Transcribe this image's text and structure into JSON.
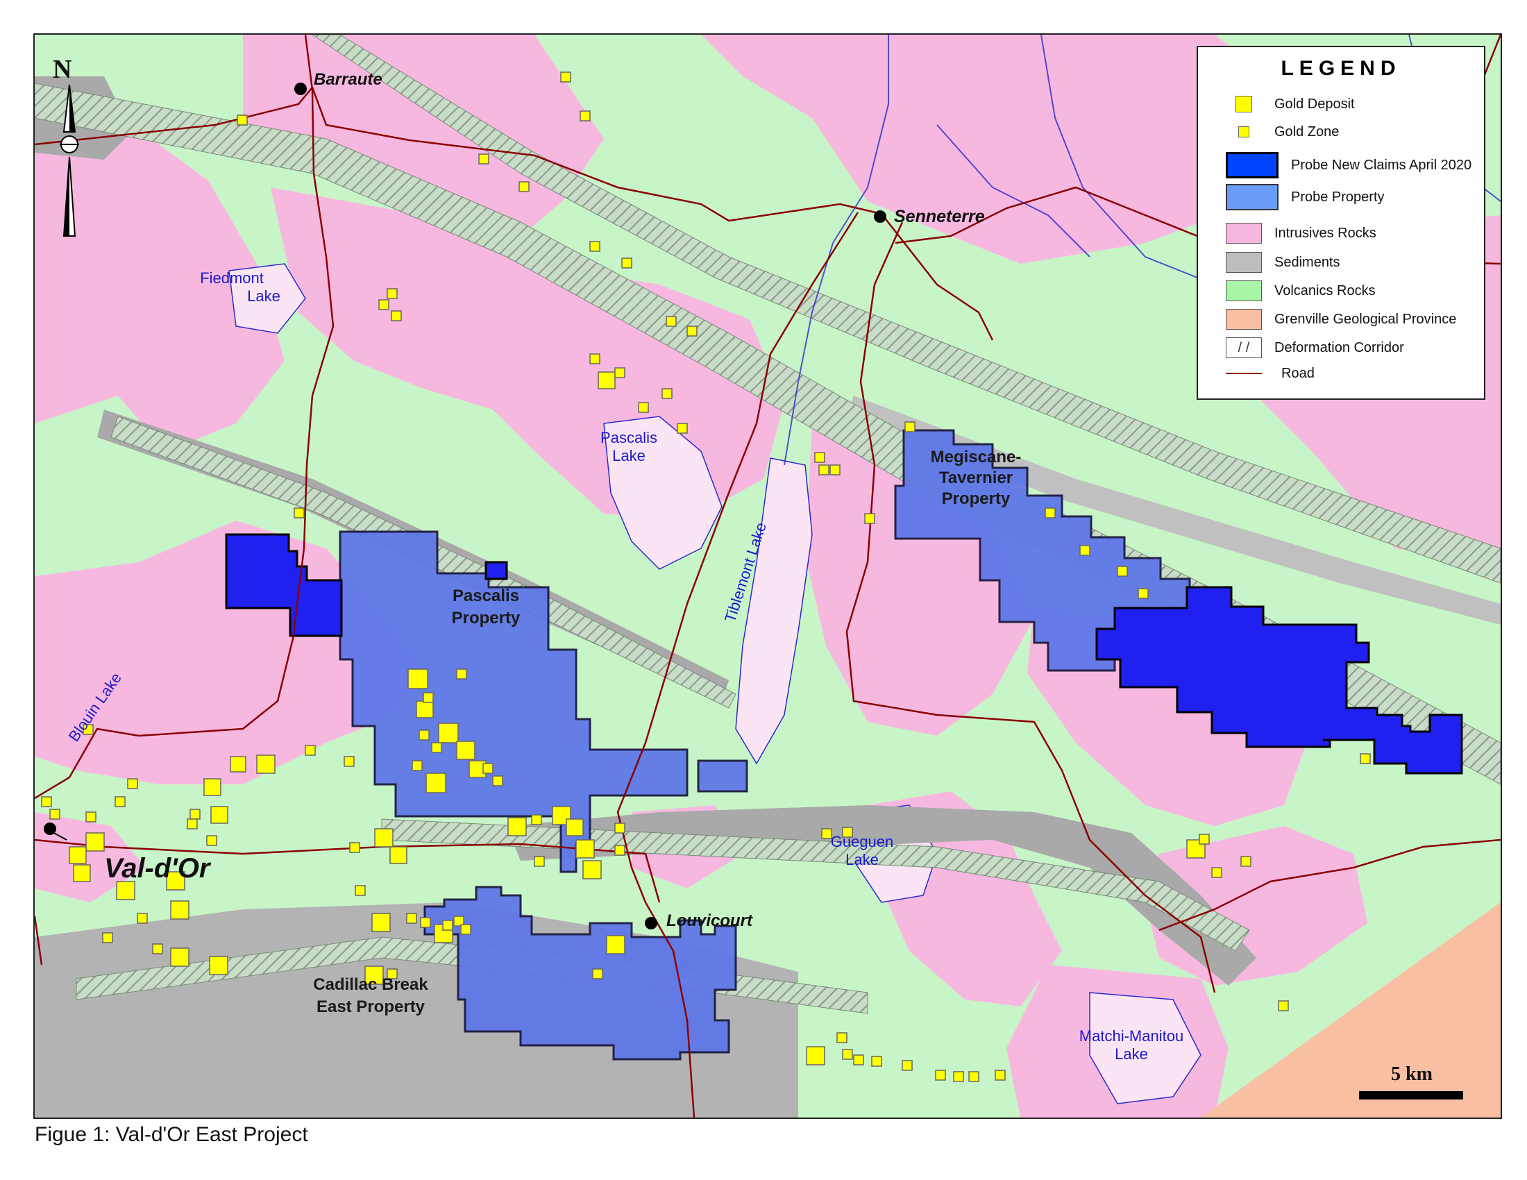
{
  "caption": "Figue 1: Val-d'Or East Project",
  "north_label": "N",
  "scale_label": "5 km",
  "legend": {
    "title": "LEGEND",
    "items": [
      {
        "label": "Gold Deposit",
        "swatch": "gold-deposit",
        "color": "#ffff00"
      },
      {
        "label": "Gold Zone",
        "swatch": "gold-zone",
        "color": "#ffff00"
      },
      {
        "label": "Probe New Claims April 2020",
        "swatch": "new-claims",
        "color": "#1a1aff"
      },
      {
        "label": "Probe Property",
        "swatch": "property",
        "color": "#6b8cf5"
      },
      {
        "label": "Intrusives Rocks",
        "swatch": "intrusives",
        "color": "#f7b8e0"
      },
      {
        "label": "Sediments",
        "swatch": "sediments",
        "color": "#bdbdbd"
      },
      {
        "label": "Volcanics Rocks",
        "swatch": "volcanics",
        "color": "#a8f5a8"
      },
      {
        "label": "Grenville Geological Province",
        "swatch": "grenville",
        "color": "#f9bfa3"
      },
      {
        "label": "Deformation Corridor",
        "swatch": "deformation",
        "color": "#ffffff"
      },
      {
        "label": "Road",
        "swatch": "road",
        "color": "#8b0000"
      }
    ]
  },
  "towns": {
    "barraute": "Barraute",
    "senneterre": "Senneterre",
    "val_dor": "Val-d'Or",
    "louvicourt": "Louvicourt"
  },
  "lakes": {
    "fiedmont_1": "Fiedmont",
    "fiedmont_2": "Lake",
    "pascalis_1": "Pascalis",
    "pascalis_2": "Lake",
    "blouin": "Blouin Lake",
    "tiblemont": "Tiblemont Lake",
    "gueguen_1": "Gueguen",
    "gueguen_2": "Lake",
    "matchi_1": "Matchi-Manitou",
    "matchi_2": "Lake"
  },
  "properties": {
    "pascalis_1": "Pascalis",
    "pascalis_2": "Property",
    "megiscane_1": "Megiscane-",
    "megiscane_2": "Tavernier",
    "megiscane_3": "Property",
    "cadillac_1": "Cadillac Break",
    "cadillac_2": "East Property"
  },
  "colors": {
    "volcanics": "#c8f5c8",
    "intrusives": "#f7b8e0",
    "sediments": "#a9a9a9",
    "grenville": "#f9bfa3",
    "property": "#5f78e8",
    "new_claims": "#2020f0",
    "road": "#8b0000",
    "water": "#2a2acc",
    "gold": "#ffff00"
  }
}
